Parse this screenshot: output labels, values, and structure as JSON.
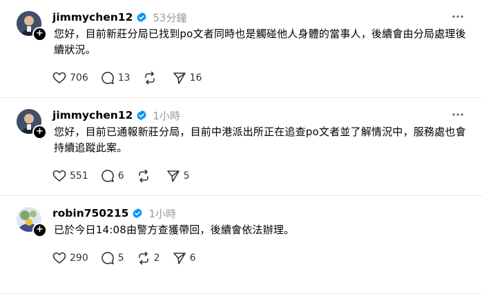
{
  "posts": [
    {
      "username": "jimmychen12",
      "time": "53分鐘",
      "text": "您好，目前新莊分局已找到po文者同時也是觸碰他人身體的當事人，後續會由分局處理後續狀況。",
      "likes": "706",
      "comments": "13",
      "reposts": "",
      "shares": "16"
    },
    {
      "username": "jimmychen12",
      "time": "1小時",
      "text": "您好，目前已通報新莊分局，目前中港派出所正在追查po文者並了解情況中，服務處也會持續追蹤此案。",
      "likes": "551",
      "comments": "6",
      "reposts": "",
      "shares": "5"
    },
    {
      "username": "robin750215",
      "time": "1小時",
      "text": "已於今日14:08由警方查獲帶回，後續會依法辦理。",
      "likes": "290",
      "comments": "5",
      "reposts": "2",
      "shares": "6"
    }
  ],
  "colors": {
    "verified": "#0095f6",
    "muted": "#999999",
    "divider": "#e5e5e5"
  },
  "icons": [
    "plus-icon",
    "verified-icon",
    "more-icon",
    "heart-icon",
    "comment-icon",
    "repost-icon",
    "share-icon"
  ]
}
